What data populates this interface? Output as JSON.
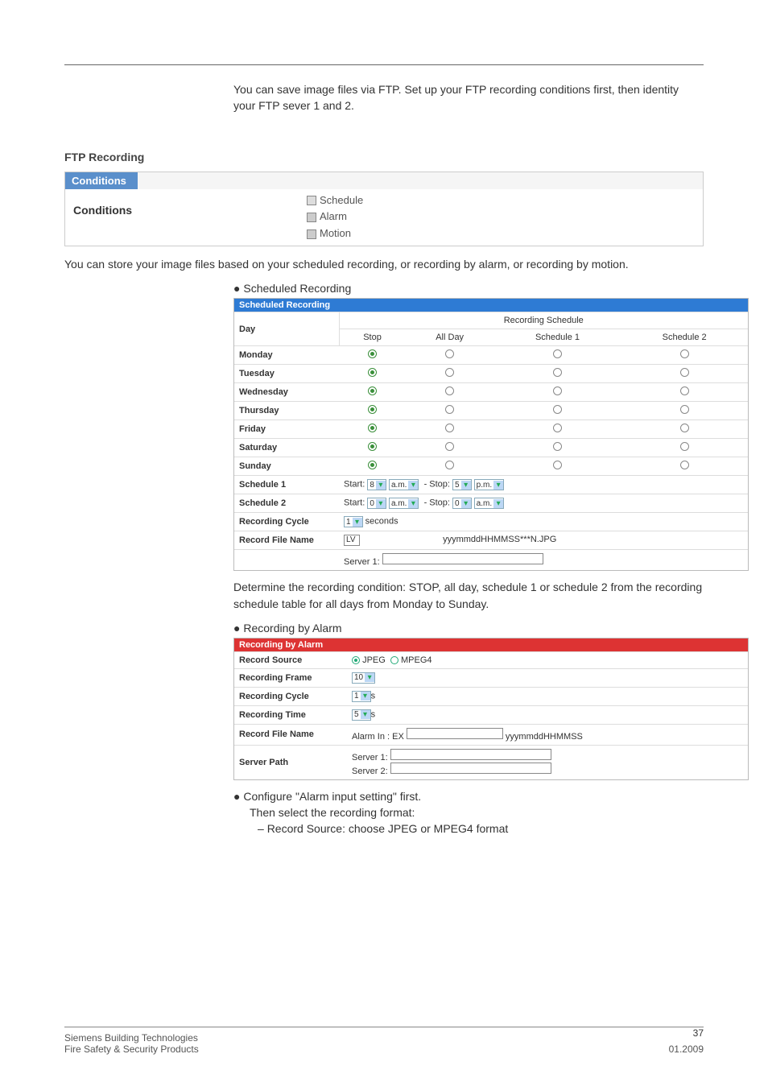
{
  "intro": "You can save image files via FTP. Set up your FTP recording conditions first, then identity your FTP sever 1 and 2.",
  "ftp_heading": "FTP Recording",
  "conditions": {
    "header": "Conditions",
    "label": "Conditions",
    "options": [
      "Schedule",
      "Alarm",
      "Motion"
    ]
  },
  "store_para": "You can store your image files based on your scheduled recording, or recording by alarm, or recording by motion.",
  "sched_bullet": "Scheduled Recording",
  "sched_table": {
    "title": "Scheduled Recording",
    "day_label": "Day",
    "rec_sched_label": "Recording Schedule",
    "cols": [
      "Stop",
      "All Day",
      "Schedule 1",
      "Schedule 2"
    ],
    "days": [
      "Monday",
      "Tuesday",
      "Wednesday",
      "Thursday",
      "Friday",
      "Saturday",
      "Sunday"
    ],
    "sched1": {
      "label": "Schedule 1",
      "start_lbl": "Start:",
      "start_val": "8",
      "start_ap": "a.m.",
      "stop_lbl": "- Stop:",
      "stop_val": "5",
      "stop_ap": "p.m."
    },
    "sched2": {
      "label": "Schedule 2",
      "start_lbl": "Start:",
      "start_val": "0",
      "start_ap": "a.m.",
      "stop_lbl": "- Stop:",
      "stop_val": "0",
      "stop_ap": "a.m."
    },
    "cycle": {
      "label": "Recording Cycle",
      "val": "1",
      "unit": "seconds"
    },
    "fname": {
      "label": "Record File Name",
      "prefix": "LV",
      "suffix": "yyymmddHHMMSS***N.JPG"
    },
    "server1": "Server 1:"
  },
  "sched_desc": "Determine the recording condition: STOP, all day, schedule 1 or schedule 2 from the recording schedule table for all days from Monday to Sunday.",
  "alarm_bullet": "Recording by Alarm",
  "alarm_table": {
    "title": "Recording by Alarm",
    "source": {
      "label": "Record Source",
      "opt1": "JPEG",
      "opt2": "MPEG4"
    },
    "frame": {
      "label": "Recording Frame",
      "val": "10"
    },
    "cycle": {
      "label": "Recording Cycle",
      "val": "1",
      "unit": "s"
    },
    "time": {
      "label": "Recording Time",
      "val": "5",
      "unit": "s"
    },
    "fname": {
      "label": "Record File Name",
      "prefix": "Alarm In : EX",
      "suffix": "yyymmddHHMMSS"
    },
    "path": {
      "label": "Server Path",
      "s1": "Server 1:",
      "s2": "Server 2:"
    }
  },
  "config_bullet": "Configure \"Alarm input setting\" first.",
  "config_sub": "Then select the recording format:",
  "config_dash": "Record Source: choose JPEG or MPEG4 format",
  "page_no": "37",
  "footer_left1": "Siemens Building Technologies",
  "footer_left2": "Fire Safety & Security Products",
  "footer_right": "01.2009"
}
